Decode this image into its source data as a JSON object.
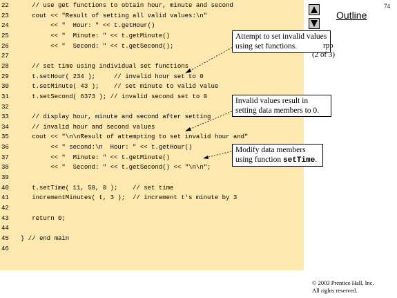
{
  "slide": {
    "page_number": "74",
    "outline_label": "Outline",
    "figure_name": "rpp",
    "figure_part": "(2 of 3)",
    "copyright_line1": "© 2003 Prentice Hall, Inc.",
    "copyright_line2": "All rights reserved."
  },
  "code_lines": [
    {
      "num": "22",
      "text": "   // use get functions to obtain hour, minute and second"
    },
    {
      "num": "23",
      "text": "   cout << \"Result of setting all valid values:\\n\""
    },
    {
      "num": "24",
      "text": "        << \"  Hour: \" << t.getHour()"
    },
    {
      "num": "25",
      "text": "        << \"  Minute: \" << t.getMinute()"
    },
    {
      "num": "26",
      "text": "        << \"  Second: \" << t.getSecond();"
    },
    {
      "num": "27",
      "text": ""
    },
    {
      "num": "28",
      "text": "   // set time using individual set functions"
    },
    {
      "num": "29",
      "text": "   t.setHour( 234 );     // invalid hour set to 0"
    },
    {
      "num": "30",
      "text": "   t.setMinute( 43 );    // set minute to valid value"
    },
    {
      "num": "31",
      "text": "   t.setSecond( 6373 ); // invalid second set to 0"
    },
    {
      "num": "32",
      "text": ""
    },
    {
      "num": "33",
      "text": "   // display hour, minute and second after setting"
    },
    {
      "num": "34",
      "text": "   // invalid hour and second values"
    },
    {
      "num": "35",
      "text": "   cout << \"\\n\\nResult of attempting to set invalid hour and\""
    },
    {
      "num": "36",
      "text": "        << \" second:\\n  Hour: \" << t.getHour()"
    },
    {
      "num": "37",
      "text": "        << \"  Minute: \" << t.getMinute()"
    },
    {
      "num": "38",
      "text": "        << \"  Second: \" << t.getSecond() << \"\\n\\n\";"
    },
    {
      "num": "39",
      "text": ""
    },
    {
      "num": "40",
      "text": "   t.setTime( 11, 58, 0 );    // set time"
    },
    {
      "num": "41",
      "text": "   incrementMinutes( t, 3 );  // increment t's minute by 3"
    },
    {
      "num": "42",
      "text": ""
    },
    {
      "num": "43",
      "text": "   return 0;"
    },
    {
      "num": "44",
      "text": ""
    },
    {
      "num": "45",
      "text": "} // end main"
    },
    {
      "num": "46",
      "text": ""
    }
  ],
  "callouts": {
    "c1": "Attempt to set invalid values using set functions.",
    "c2": "Invalid values result in setting data members to 0.",
    "c3_text": "Modify data members using function ",
    "c3_code": "setTime",
    "c3_end": "."
  },
  "nav": {
    "up_icon": "triangle-up-icon",
    "down_icon": "triangle-down-icon"
  }
}
